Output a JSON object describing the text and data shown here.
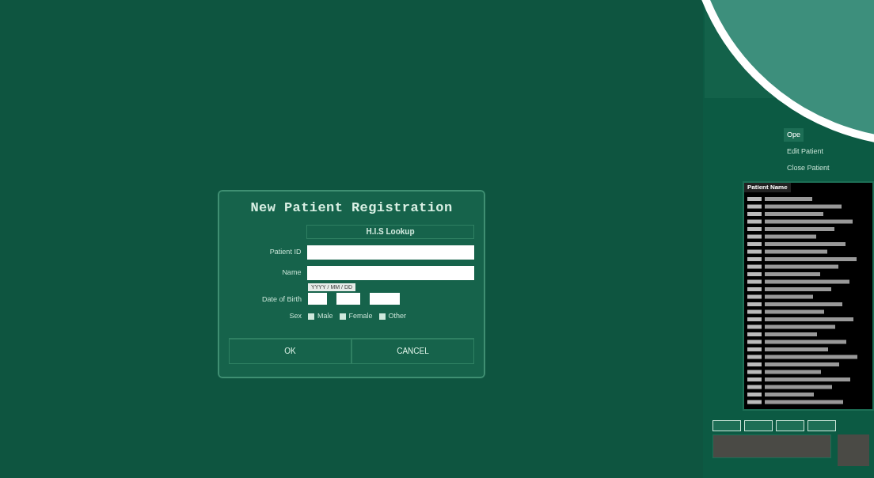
{
  "dialog": {
    "title": "New Patient Registration",
    "lookup_button": "H.I.S Lookup",
    "fields": [
      {
        "label": "Patient ID"
      },
      {
        "label": "Name"
      }
    ],
    "dob": {
      "label": "Date of Birth",
      "hint": "YYYY / MM / DD"
    },
    "sex": {
      "label": "Sex",
      "options": [
        {
          "label": "Male",
          "checked": true
        },
        {
          "label": "Female",
          "checked": true
        },
        {
          "label": "Other",
          "checked": true
        }
      ]
    },
    "buttons": [
      "OK",
      "CANCEL"
    ]
  },
  "side_menu": [
    {
      "label": "Ope",
      "selected": true
    },
    {
      "label": "Edit Patient",
      "selected": false
    },
    {
      "label": "Close Patient",
      "selected": false
    }
  ],
  "patient_list": {
    "header": "Patient Name"
  }
}
